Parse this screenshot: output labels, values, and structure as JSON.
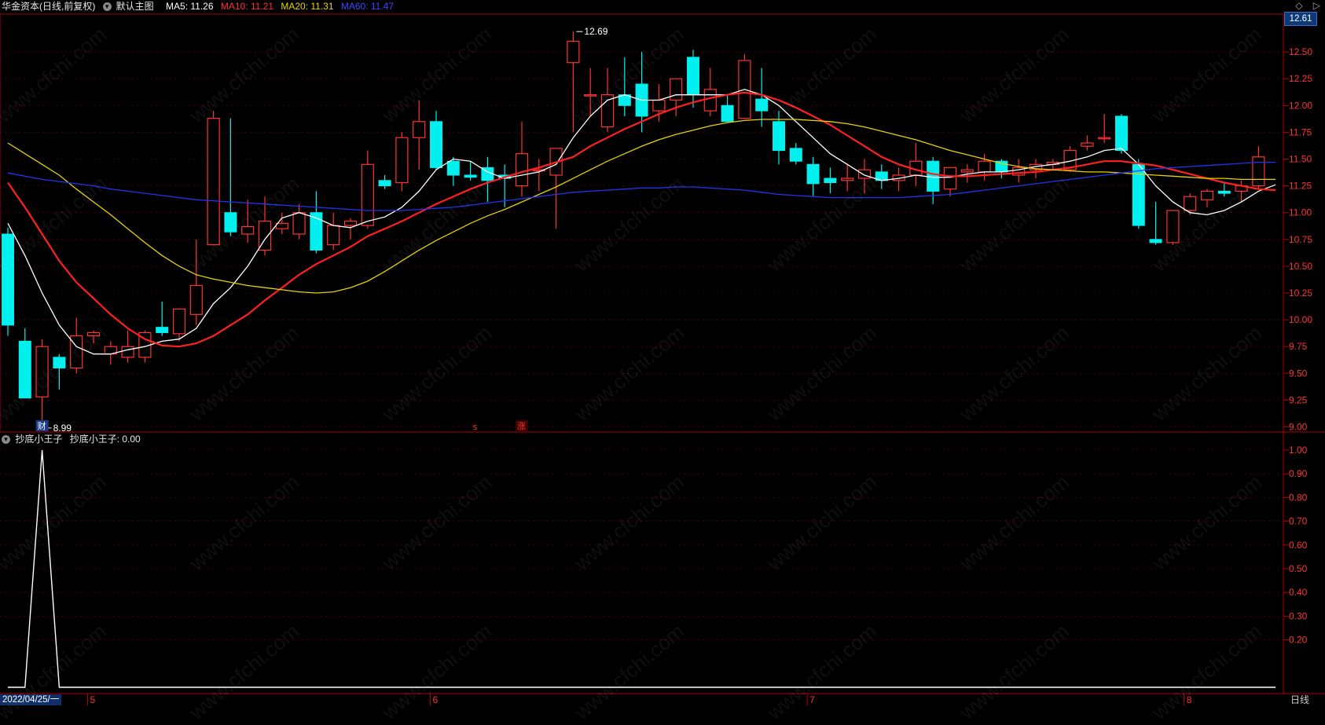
{
  "header": {
    "title": "华金资本(日线,前复权)",
    "layout_label": "默认主图",
    "ma5": "MA5: 11.26",
    "ma10": "MA10: 11.21",
    "ma20": "MA20: 11.31",
    "ma60": "MA60: 11.47"
  },
  "right_top": {
    "diamond": "◇",
    "arrow": "▷"
  },
  "current_price_tag": "12.61",
  "sub_header": {
    "indicator": "抄底小王子",
    "value_label": "抄底小王子: 0.00"
  },
  "date_cursor": "2022/04/25/一",
  "period_button": "日线",
  "markers": {
    "cai": "财",
    "s": "s",
    "zhang": "涨"
  },
  "annotations": {
    "high": "12.69",
    "low": "8.99"
  },
  "watermark": "www.cfchi.com",
  "colors": {
    "up": "#ff3232",
    "down": "#00f0f0",
    "ma5": "#ffffff",
    "ma10": "#ff2020",
    "ma20": "#e6d200",
    "ma60": "#2233ee",
    "axis": "#b00000",
    "grid": "#6a0000"
  },
  "chart_data": [
    {
      "type": "candlestick",
      "title": "华金资本(日线,前复权)",
      "ylim": [
        8.9,
        12.61
      ],
      "yticks": [
        "12.50",
        "12.25",
        "12.00",
        "11.75",
        "11.50",
        "11.25",
        "11.00",
        "10.75",
        "10.50",
        "10.25",
        "10.00",
        "9.75",
        "9.50",
        "9.25",
        "9.00"
      ],
      "month_labels": [
        "5",
        "6",
        "7",
        "8"
      ],
      "month_label_index": [
        5,
        25,
        47,
        69
      ],
      "candles": [
        {
          "o": 10.8,
          "h": 10.86,
          "l": 9.85,
          "c": 9.95
        },
        {
          "o": 9.8,
          "h": 9.92,
          "l": 9.4,
          "c": 9.27
        },
        {
          "o": 9.28,
          "h": 9.82,
          "l": 8.99,
          "c": 9.75
        },
        {
          "o": 9.65,
          "h": 9.68,
          "l": 9.35,
          "c": 9.55
        },
        {
          "o": 9.55,
          "h": 10.02,
          "l": 9.5,
          "c": 9.85
        },
        {
          "o": 9.85,
          "h": 9.9,
          "l": 9.78,
          "c": 9.88
        },
        {
          "o": 9.68,
          "h": 9.8,
          "l": 9.58,
          "c": 9.75
        },
        {
          "o": 9.65,
          "h": 9.9,
          "l": 9.6,
          "c": 9.75
        },
        {
          "o": 9.65,
          "h": 9.9,
          "l": 9.6,
          "c": 9.88
        },
        {
          "o": 9.93,
          "h": 10.17,
          "l": 9.85,
          "c": 9.88
        },
        {
          "o": 9.87,
          "h": 10.1,
          "l": 9.8,
          "c": 10.1
        },
        {
          "o": 10.05,
          "h": 10.75,
          "l": 9.95,
          "c": 10.32
        },
        {
          "o": 10.7,
          "h": 11.95,
          "l": 10.85,
          "c": 11.88
        },
        {
          "o": 11.0,
          "h": 11.88,
          "l": 10.78,
          "c": 10.82
        },
        {
          "o": 10.8,
          "h": 11.12,
          "l": 10.72,
          "c": 10.87
        },
        {
          "o": 10.65,
          "h": 11.15,
          "l": 10.6,
          "c": 10.92
        },
        {
          "o": 10.85,
          "h": 11.0,
          "l": 10.8,
          "c": 10.9
        },
        {
          "o": 10.8,
          "h": 11.08,
          "l": 10.75,
          "c": 11.0
        },
        {
          "o": 11.0,
          "h": 11.2,
          "l": 10.62,
          "c": 10.65
        },
        {
          "o": 10.7,
          "h": 11.0,
          "l": 10.65,
          "c": 10.88
        },
        {
          "o": 10.88,
          "h": 10.95,
          "l": 10.75,
          "c": 10.92
        },
        {
          "o": 10.88,
          "h": 11.58,
          "l": 10.85,
          "c": 11.45
        },
        {
          "o": 11.3,
          "h": 11.35,
          "l": 11.22,
          "c": 11.25
        },
        {
          "o": 11.28,
          "h": 11.75,
          "l": 11.2,
          "c": 11.7
        },
        {
          "o": 11.7,
          "h": 12.05,
          "l": 11.4,
          "c": 11.85
        },
        {
          "o": 11.85,
          "h": 11.95,
          "l": 11.4,
          "c": 11.42
        },
        {
          "o": 11.48,
          "h": 11.52,
          "l": 11.25,
          "c": 11.35
        },
        {
          "o": 11.35,
          "h": 11.48,
          "l": 11.3,
          "c": 11.33
        },
        {
          "o": 11.42,
          "h": 11.52,
          "l": 11.1,
          "c": 11.3
        },
        {
          "o": 11.35,
          "h": 11.45,
          "l": 11.05,
          "c": 11.32
        },
        {
          "o": 11.25,
          "h": 11.85,
          "l": 11.15,
          "c": 11.55
        },
        {
          "o": 11.4,
          "h": 11.5,
          "l": 11.2,
          "c": 11.4
        },
        {
          "o": 11.35,
          "h": 11.6,
          "l": 10.85,
          "c": 11.6
        },
        {
          "o": 12.4,
          "h": 12.69,
          "l": 11.75,
          "c": 12.6
        },
        {
          "o": 12.1,
          "h": 12.35,
          "l": 11.9,
          "c": 12.1
        },
        {
          "o": 11.8,
          "h": 12.35,
          "l": 11.75,
          "c": 12.1
        },
        {
          "o": 12.1,
          "h": 12.45,
          "l": 11.9,
          "c": 12.0
        },
        {
          "o": 12.2,
          "h": 12.5,
          "l": 11.75,
          "c": 11.9
        },
        {
          "o": 11.95,
          "h": 12.2,
          "l": 11.85,
          "c": 12.05
        },
        {
          "o": 12.05,
          "h": 12.25,
          "l": 11.9,
          "c": 12.25
        },
        {
          "o": 12.45,
          "h": 12.52,
          "l": 11.98,
          "c": 12.1
        },
        {
          "o": 11.95,
          "h": 12.35,
          "l": 11.9,
          "c": 12.15
        },
        {
          "o": 12.0,
          "h": 12.1,
          "l": 11.85,
          "c": 11.85
        },
        {
          "o": 11.88,
          "h": 12.48,
          "l": 11.9,
          "c": 12.42
        },
        {
          "o": 12.06,
          "h": 12.35,
          "l": 11.8,
          "c": 11.95
        },
        {
          "o": 11.85,
          "h": 11.95,
          "l": 11.45,
          "c": 11.58
        },
        {
          "o": 11.6,
          "h": 11.65,
          "l": 11.45,
          "c": 11.48
        },
        {
          "o": 11.45,
          "h": 11.52,
          "l": 11.15,
          "c": 11.27
        },
        {
          "o": 11.32,
          "h": 11.42,
          "l": 11.18,
          "c": 11.28
        },
        {
          "o": 11.3,
          "h": 11.45,
          "l": 11.2,
          "c": 11.32
        },
        {
          "o": 11.32,
          "h": 11.5,
          "l": 11.18,
          "c": 11.4
        },
        {
          "o": 11.38,
          "h": 11.45,
          "l": 11.22,
          "c": 11.3
        },
        {
          "o": 11.3,
          "h": 11.42,
          "l": 11.2,
          "c": 11.35
        },
        {
          "o": 11.35,
          "h": 11.65,
          "l": 11.25,
          "c": 11.48
        },
        {
          "o": 11.48,
          "h": 11.52,
          "l": 11.08,
          "c": 11.2
        },
        {
          "o": 11.22,
          "h": 11.38,
          "l": 11.15,
          "c": 11.42
        },
        {
          "o": 11.38,
          "h": 11.45,
          "l": 11.28,
          "c": 11.4
        },
        {
          "o": 11.38,
          "h": 11.55,
          "l": 11.3,
          "c": 11.48
        },
        {
          "o": 11.48,
          "h": 11.5,
          "l": 11.32,
          "c": 11.38
        },
        {
          "o": 11.35,
          "h": 11.5,
          "l": 11.28,
          "c": 11.42
        },
        {
          "o": 11.4,
          "h": 11.5,
          "l": 11.32,
          "c": 11.45
        },
        {
          "o": 11.45,
          "h": 11.5,
          "l": 11.4,
          "c": 11.47
        },
        {
          "o": 11.4,
          "h": 11.62,
          "l": 11.38,
          "c": 11.58
        },
        {
          "o": 11.62,
          "h": 11.72,
          "l": 11.58,
          "c": 11.65
        },
        {
          "o": 11.7,
          "h": 11.92,
          "l": 11.65,
          "c": 11.7
        },
        {
          "o": 11.9,
          "h": 11.92,
          "l": 11.55,
          "c": 11.58
        },
        {
          "o": 11.45,
          "h": 11.5,
          "l": 10.85,
          "c": 10.88
        },
        {
          "o": 10.75,
          "h": 11.1,
          "l": 10.7,
          "c": 10.72
        },
        {
          "o": 10.72,
          "h": 11.0,
          "l": 10.7,
          "c": 11.02
        },
        {
          "o": 11.02,
          "h": 11.18,
          "l": 10.98,
          "c": 11.15
        },
        {
          "o": 11.12,
          "h": 11.22,
          "l": 11.05,
          "c": 11.2
        },
        {
          "o": 11.2,
          "h": 11.28,
          "l": 11.15,
          "c": 11.18
        },
        {
          "o": 11.2,
          "h": 11.3,
          "l": 11.1,
          "c": 11.25
        },
        {
          "o": 11.25,
          "h": 11.62,
          "l": 11.22,
          "c": 11.52
        }
      ],
      "series": [
        {
          "name": "MA5",
          "values": [
            10.9,
            10.6,
            10.25,
            9.95,
            9.75,
            9.68,
            9.68,
            9.72,
            9.75,
            9.8,
            9.82,
            9.92,
            10.15,
            10.3,
            10.5,
            10.75,
            10.95,
            11.0,
            10.95,
            10.88,
            10.86,
            10.92,
            10.96,
            11.05,
            11.2,
            11.4,
            11.5,
            11.48,
            11.38,
            11.32,
            11.35,
            11.38,
            11.45,
            11.7,
            11.9,
            12.05,
            12.1,
            12.05,
            12.05,
            12.1,
            12.1,
            12.1,
            12.1,
            12.15,
            12.1,
            12.0,
            11.85,
            11.7,
            11.55,
            11.45,
            11.35,
            11.3,
            11.32,
            11.35,
            11.33,
            11.33,
            11.36,
            11.38,
            11.38,
            11.4,
            11.43,
            11.45,
            11.48,
            11.52,
            11.58,
            11.6,
            11.45,
            11.25,
            11.1,
            11.0,
            10.98,
            11.02,
            11.1,
            11.2,
            11.26
          ]
        },
        {
          "name": "MA10",
          "values": [
            11.28,
            11.05,
            10.8,
            10.55,
            10.35,
            10.2,
            10.05,
            9.92,
            9.82,
            9.76,
            9.75,
            9.78,
            9.85,
            9.95,
            10.05,
            10.18,
            10.3,
            10.42,
            10.52,
            10.6,
            10.68,
            10.78,
            10.85,
            10.92,
            11.0,
            11.08,
            11.15,
            11.22,
            11.28,
            11.33,
            11.38,
            11.42,
            11.47,
            11.52,
            11.62,
            11.7,
            11.78,
            11.85,
            11.92,
            11.98,
            12.03,
            12.07,
            12.1,
            12.12,
            12.1,
            12.05,
            11.98,
            11.9,
            11.82,
            11.72,
            11.62,
            11.52,
            11.45,
            11.4,
            11.36,
            11.34,
            11.34,
            11.35,
            11.36,
            11.37,
            11.38,
            11.4,
            11.42,
            11.45,
            11.48,
            11.48,
            11.46,
            11.44,
            11.4,
            11.36,
            11.32,
            11.28,
            11.25,
            11.22,
            11.21
          ]
        },
        {
          "name": "MA20",
          "values": [
            11.65,
            11.55,
            11.45,
            11.35,
            11.22,
            11.1,
            10.98,
            10.85,
            10.72,
            10.6,
            10.5,
            10.42,
            10.38,
            10.35,
            10.32,
            10.3,
            10.28,
            10.26,
            10.25,
            10.26,
            10.3,
            10.36,
            10.45,
            10.55,
            10.65,
            10.74,
            10.82,
            10.9,
            10.97,
            11.03,
            11.1,
            11.17,
            11.24,
            11.32,
            11.4,
            11.48,
            11.55,
            11.62,
            11.68,
            11.73,
            11.77,
            11.81,
            11.84,
            11.86,
            11.87,
            11.87,
            11.87,
            11.86,
            11.85,
            11.83,
            11.8,
            11.76,
            11.72,
            11.68,
            11.63,
            11.58,
            11.54,
            11.5,
            11.46,
            11.43,
            11.41,
            11.4,
            11.39,
            11.38,
            11.38,
            11.37,
            11.36,
            11.35,
            11.34,
            11.33,
            11.32,
            11.32,
            11.31,
            11.31,
            11.31
          ]
        },
        {
          "name": "MA60",
          "values": [
            11.37,
            11.34,
            11.31,
            11.29,
            11.27,
            11.25,
            11.22,
            11.2,
            11.18,
            11.16,
            11.14,
            11.12,
            11.11,
            11.1,
            11.09,
            11.08,
            11.07,
            11.06,
            11.05,
            11.04,
            11.03,
            11.02,
            11.02,
            11.02,
            11.03,
            11.04,
            11.05,
            11.07,
            11.09,
            11.11,
            11.13,
            11.15,
            11.17,
            11.19,
            11.2,
            11.21,
            11.22,
            11.23,
            11.23,
            11.24,
            11.24,
            11.23,
            11.22,
            11.21,
            11.19,
            11.17,
            11.16,
            11.15,
            11.14,
            11.14,
            11.14,
            11.14,
            11.14,
            11.15,
            11.16,
            11.17,
            11.19,
            11.21,
            11.23,
            11.25,
            11.27,
            11.29,
            11.31,
            11.33,
            11.35,
            11.37,
            11.39,
            11.41,
            11.42,
            11.43,
            11.44,
            11.45,
            11.46,
            11.47,
            11.47
          ]
        }
      ]
    },
    {
      "type": "line",
      "title": "抄底小王子",
      "ylim": [
        0,
        1.05
      ],
      "yticks": [
        "1.00",
        "0.90",
        "0.80",
        "0.70",
        "0.60",
        "0.50",
        "0.40",
        "0.30",
        "0.20"
      ],
      "series": [
        {
          "name": "抄底小王子",
          "values": [
            0,
            0,
            1,
            0,
            0,
            0,
            0,
            0,
            0,
            0,
            0,
            0,
            0,
            0,
            0,
            0,
            0,
            0,
            0,
            0,
            0,
            0,
            0,
            0,
            0,
            0,
            0,
            0,
            0,
            0,
            0,
            0,
            0,
            0,
            0,
            0,
            0,
            0,
            0,
            0,
            0,
            0,
            0,
            0,
            0,
            0,
            0,
            0,
            0,
            0,
            0,
            0,
            0,
            0,
            0,
            0,
            0,
            0,
            0,
            0,
            0,
            0,
            0,
            0,
            0,
            0,
            0,
            0,
            0,
            0,
            0,
            0,
            0,
            0,
            0
          ]
        }
      ]
    }
  ]
}
